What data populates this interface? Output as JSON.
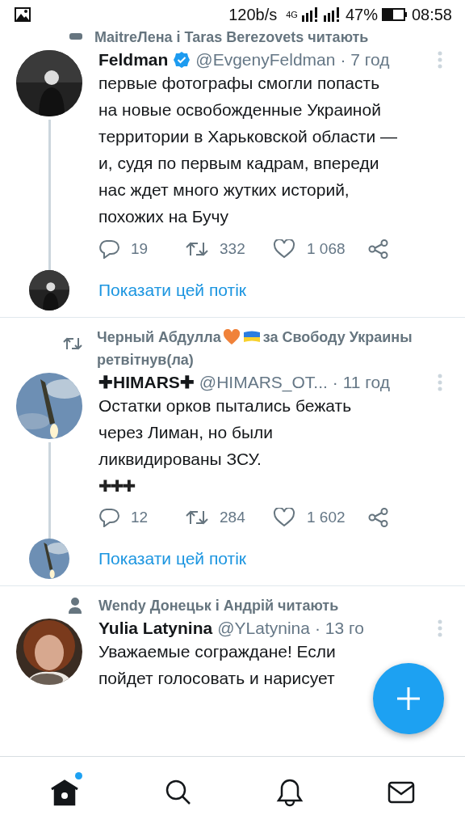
{
  "status_bar": {
    "speed": "120b/s",
    "network": "4G",
    "battery": "47%",
    "time": "08:58"
  },
  "top_context": {
    "text": "MaitreЛена і Taras Berezovets читають"
  },
  "tweets": [
    {
      "kind": "plain",
      "name": "Feldman",
      "verified": true,
      "handle": "@EvgenyFeldman",
      "time": "· 7 год",
      "body": "первые фотографы смогли попасть\nна новые освобожденные Украиной\nтерритории в Харьковской области —\nи, судя по первым кадрам, впереди\nнас ждет много жутких историй,\nпохожих на Бучу",
      "reply": "19",
      "retweet": "332",
      "like": "1 068",
      "thread": "Показати цей потік"
    },
    {
      "kind": "retweet",
      "context": "Черный Абдулла",
      "context_tail": "за Свободу Украины",
      "context_line2": "ретвітнув(ла)",
      "name": "✚HIMARS✚",
      "verified": false,
      "handle": "@HIMARS_OT...",
      "time": "· 11 год",
      "body": "Остатки орков пытались бежать\nчерез Лиман, но были\nликвидированы ЗСУ.",
      "extra": "✚✚✚",
      "reply": "12",
      "retweet": "284",
      "like": "1 602",
      "thread": "Показати цей потік"
    },
    {
      "kind": "follow",
      "context": "Wendy Донецьк і Андрій читають",
      "name": "Yulia Latynina",
      "verified": false,
      "handle": "@YLatynina",
      "time": "· 13 го",
      "body": "Уважаемые сограждане! Если\nпойдет голосовать и нарисует"
    }
  ],
  "nav": [
    {
      "kind": "home",
      "selected": true,
      "badge": true
    },
    {
      "kind": "search",
      "selected": false,
      "badge": false
    },
    {
      "kind": "bell",
      "selected": false,
      "badge": false
    },
    {
      "kind": "mail",
      "selected": false,
      "badge": false
    }
  ]
}
